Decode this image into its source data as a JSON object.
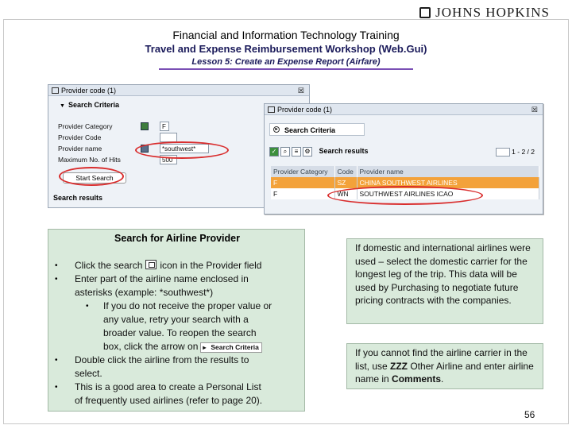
{
  "header": {
    "brand": "JOHNS HOPKINS",
    "title": "Financial and Information Technology Training",
    "subtitle": "Travel and Expense Reimbursement Workshop (Web.Gui)",
    "lesson": "Lesson 5: Create an Expense Report (Airfare)"
  },
  "screen1": {
    "window_title": "Provider code (1)",
    "criteria_label": "Search Criteria",
    "fields": [
      {
        "label": "Provider Category",
        "value": "F"
      },
      {
        "label": "Provider Code",
        "value": ""
      },
      {
        "label": "Provider name",
        "value": "*southwest*"
      },
      {
        "label": "Maximum No. of Hits",
        "value": "500"
      }
    ],
    "start_button": "Start Search",
    "results_label": "Search results"
  },
  "screen2": {
    "window_title": "Provider code (1)",
    "criteria_label": "Search Criteria",
    "results_label": "Search results",
    "pager": "1 - 2 / 2",
    "columns": [
      "Provider Category",
      "Code",
      "Provider name"
    ],
    "rows": [
      {
        "category": "F",
        "code": "SZ",
        "name": "CHINA SOUTHWEST AIRLINES",
        "selected": true
      },
      {
        "category": "F",
        "code": "WN",
        "name": "SOUTHWEST AIRLINES ICAO",
        "selected": false
      }
    ]
  },
  "instructions": {
    "heading": "Search for Airline Provider",
    "bullet1_a": "Click the search",
    "bullet1_b": "icon in the Provider field",
    "bullet2_line1": "Enter part of the airline name enclosed in",
    "bullet2_line2": "asterisks (example: *southwest*)",
    "sub_line1": "If you do not receive the proper value or",
    "sub_line2": "any value, retry your search with a",
    "sub_line3": "broader value. To reopen the search",
    "sub_line4": "box, click the arrow on",
    "sub_crit_button": "Search Criteria",
    "bullet3_line1": "Double click the airline from the results to",
    "bullet3_line2": "select.",
    "bullet4_line1": "This is a good area to create a Personal List",
    "bullet4_line2": "of frequently used airlines (refer to page 20)."
  },
  "note_domestic": "If domestic and international airlines were used – select the domestic carrier for the longest leg of the trip. This data will be used by Purchasing to negotiate future pricing contracts with the companies.",
  "note_zzz": {
    "prefix": "If you cannot find the airline carrier in the list, use ",
    "code": "ZZZ",
    "middle": " Other Airline and enter airline name in ",
    "emph": "Comments",
    "suffix": "."
  },
  "page_number": "56",
  "colors": {
    "accent_highlight": "#f3a23a",
    "annotation_red": "#d92d2d",
    "note_bg": "#d9eadb"
  }
}
